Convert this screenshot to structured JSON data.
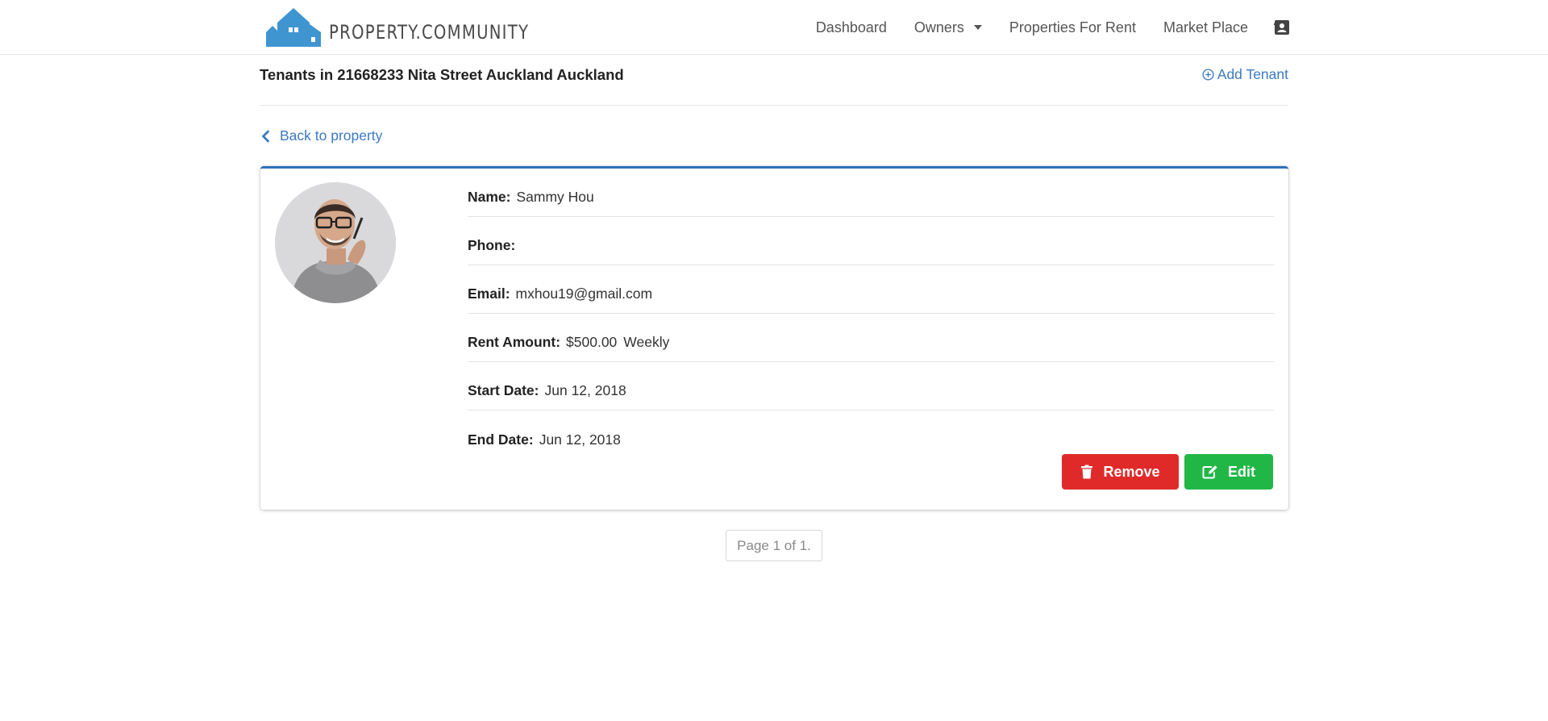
{
  "brand": {
    "name": "PROPERTY.COMMUNITY",
    "color": "#3f95cf"
  },
  "nav": {
    "items": [
      {
        "label": "Dashboard"
      },
      {
        "label": "Owners"
      },
      {
        "label": "Properties For Rent"
      },
      {
        "label": "Market Place"
      }
    ],
    "user_icon": "contact-card-icon"
  },
  "header": {
    "title": "Tenants in 21668233 Nita Street Auckland Auckland",
    "add_tenant_label": "Add Tenant"
  },
  "back_link": {
    "label": "Back to property"
  },
  "tenant": {
    "name_label": "Name:",
    "name": "Sammy Hou",
    "phone_label": "Phone:",
    "phone": "",
    "email_label": "Email:",
    "email": "mxhou19@gmail.com",
    "rent_label": "Rent Amount:",
    "rent_amount": "$500.00",
    "rent_period": "Weekly",
    "start_label": "Start Date:",
    "start_date": "Jun 12, 2018",
    "end_label": "End Date:",
    "end_date": "Jun 12, 2018"
  },
  "actions": {
    "remove_label": "Remove",
    "edit_label": "Edit"
  },
  "pagination": {
    "text": "Page 1 of 1."
  },
  "colors": {
    "link": "#3b7ac2",
    "remove": "#e02a2a",
    "edit": "#21b747",
    "card_accent": "#2d72b8"
  }
}
